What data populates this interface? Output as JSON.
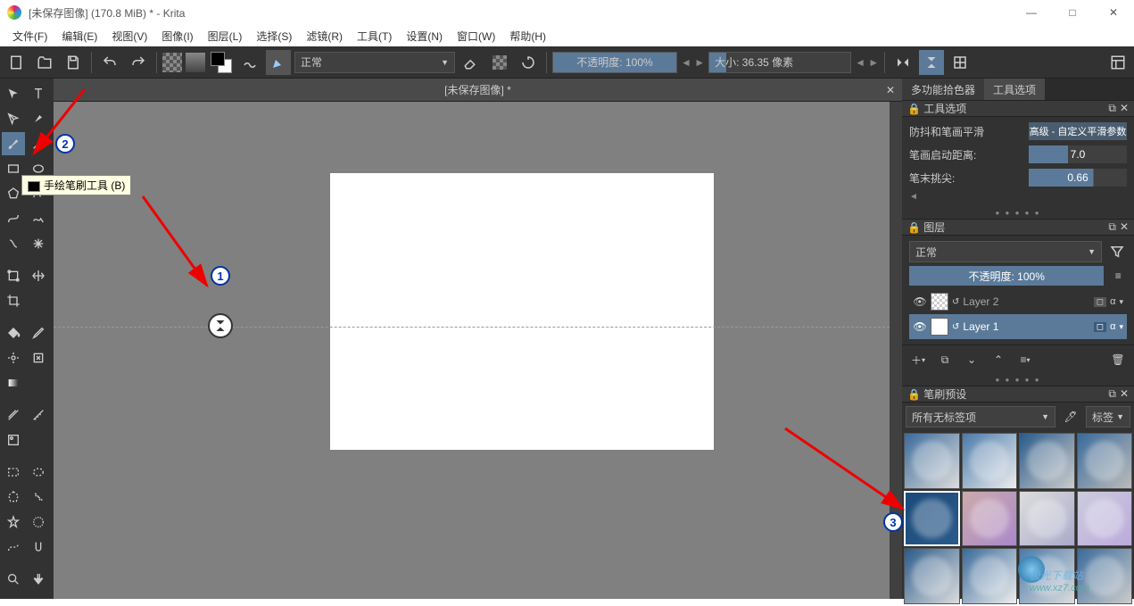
{
  "window": {
    "title": "[未保存图像] (170.8 MiB) * - Krita",
    "min": "—",
    "max": "□",
    "close": "✕"
  },
  "menu": {
    "file": "文件(F)",
    "edit": "编辑(E)",
    "view": "视图(V)",
    "image": "图像(I)",
    "layer": "图层(L)",
    "select": "选择(S)",
    "filter": "滤镜(R)",
    "tool": "工具(T)",
    "settings": "设置(N)",
    "window": "窗口(W)",
    "help": "帮助(H)"
  },
  "toolbar": {
    "blend_mode": "正常",
    "opacity_label": "不透明度:",
    "opacity_value": "100%",
    "size_label": "大小:",
    "size_value": "36.35 像素"
  },
  "doc_tab": {
    "title": "[未保存图像] *"
  },
  "tooltip": {
    "text": "手绘笔刷工具 (B)"
  },
  "right_tabs": {
    "picker": "多功能拾色器",
    "tool_options": "工具选项"
  },
  "tool_options": {
    "header": "工具选项",
    "stab_label": "防抖和笔画平滑",
    "stab_value": "高级 - 自定义平滑参数",
    "dist_label": "笔画启动距离:",
    "dist_value": "7.0",
    "tip_label": "笔末挑尖:",
    "tip_value": "0.66"
  },
  "layers": {
    "header": "图层",
    "blend": "正常",
    "opacity": "不透明度: 100%",
    "items": [
      {
        "name": "Layer 2",
        "selected": false
      },
      {
        "name": "Layer 1",
        "selected": true
      }
    ]
  },
  "presets": {
    "header": "笔刷预设",
    "filter": "所有无标签项",
    "tag_label": "标签"
  },
  "annotations": {
    "n1": "1",
    "n2": "2",
    "n3": "3"
  },
  "watermark": {
    "text1": "极光下载站",
    "text2": "www.xz7.com"
  }
}
